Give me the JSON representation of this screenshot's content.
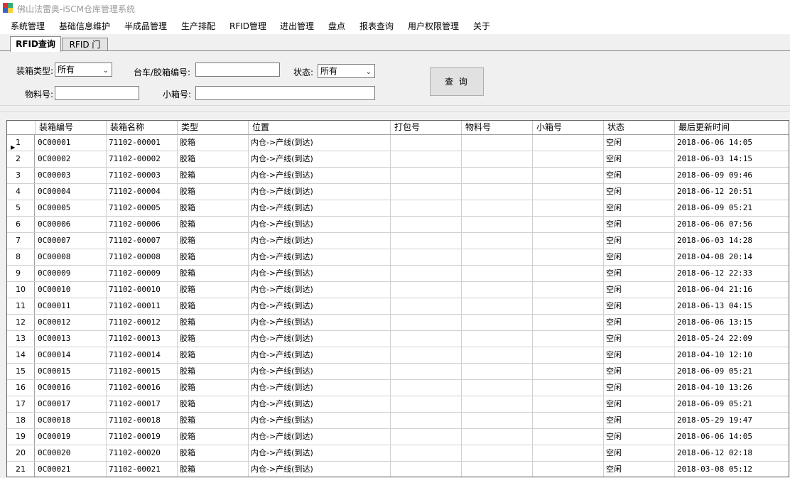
{
  "window": {
    "title": "佛山法雷奥-iSCM仓库管理系统"
  },
  "menu": [
    "系统管理",
    "基础信息维护",
    "半成品管理",
    "生产排配",
    "RFID管理",
    "进出管理",
    "盘点",
    "报表查询",
    "用户权限管理",
    "关于"
  ],
  "tabs": [
    {
      "label": "RFID查询",
      "active": true
    },
    {
      "label": "RFID 门",
      "active": false
    }
  ],
  "filters": {
    "box_type_label": "装箱类型:",
    "box_type_value": "所有",
    "cart_label": "台车/胶箱编号:",
    "cart_value": "",
    "status_label": "状态:",
    "status_value": "所有",
    "material_label": "物料号:",
    "material_value": "",
    "smallbox_label": "小箱号:",
    "smallbox_value": "",
    "query_button": "查 询"
  },
  "grid": {
    "columns": [
      "装箱编号",
      "装箱名称",
      "类型",
      "位置",
      "打包号",
      "物料号",
      "小箱号",
      "状态",
      "最后更新时间"
    ],
    "rows": [
      {
        "n": "1",
        "code": "0C00001",
        "name": "71102-00001",
        "type": "胶箱",
        "loc": "内仓->产线(到达)",
        "pack": "",
        "mat": "",
        "small": "",
        "status": "空闲",
        "time": "2018-06-06 14:05"
      },
      {
        "n": "2",
        "code": "0C00002",
        "name": "71102-00002",
        "type": "胶箱",
        "loc": "内仓->产线(到达)",
        "pack": "",
        "mat": "",
        "small": "",
        "status": "空闲",
        "time": "2018-06-03 14:15"
      },
      {
        "n": "3",
        "code": "0C00003",
        "name": "71102-00003",
        "type": "胶箱",
        "loc": "内仓->产线(到达)",
        "pack": "",
        "mat": "",
        "small": "",
        "status": "空闲",
        "time": "2018-06-09 09:46"
      },
      {
        "n": "4",
        "code": "0C00004",
        "name": "71102-00004",
        "type": "胶箱",
        "loc": "内仓->产线(到达)",
        "pack": "",
        "mat": "",
        "small": "",
        "status": "空闲",
        "time": "2018-06-12 20:51"
      },
      {
        "n": "5",
        "code": "0C00005",
        "name": "71102-00005",
        "type": "胶箱",
        "loc": "内仓->产线(到达)",
        "pack": "",
        "mat": "",
        "small": "",
        "status": "空闲",
        "time": "2018-06-09 05:21"
      },
      {
        "n": "6",
        "code": "0C00006",
        "name": "71102-00006",
        "type": "胶箱",
        "loc": "内仓->产线(到达)",
        "pack": "",
        "mat": "",
        "small": "",
        "status": "空闲",
        "time": "2018-06-06 07:56"
      },
      {
        "n": "7",
        "code": "0C00007",
        "name": "71102-00007",
        "type": "胶箱",
        "loc": "内仓->产线(到达)",
        "pack": "",
        "mat": "",
        "small": "",
        "status": "空闲",
        "time": "2018-06-03 14:28"
      },
      {
        "n": "8",
        "code": "0C00008",
        "name": "71102-00008",
        "type": "胶箱",
        "loc": "内仓->产线(到达)",
        "pack": "",
        "mat": "",
        "small": "",
        "status": "空闲",
        "time": "2018-04-08 20:14"
      },
      {
        "n": "9",
        "code": "0C00009",
        "name": "71102-00009",
        "type": "胶箱",
        "loc": "内仓->产线(到达)",
        "pack": "",
        "mat": "",
        "small": "",
        "status": "空闲",
        "time": "2018-06-12 22:33"
      },
      {
        "n": "10",
        "code": "0C00010",
        "name": "71102-00010",
        "type": "胶箱",
        "loc": "内仓->产线(到达)",
        "pack": "",
        "mat": "",
        "small": "",
        "status": "空闲",
        "time": "2018-06-04 21:16"
      },
      {
        "n": "11",
        "code": "0C00011",
        "name": "71102-00011",
        "type": "胶箱",
        "loc": "内仓->产线(到达)",
        "pack": "",
        "mat": "",
        "small": "",
        "status": "空闲",
        "time": "2018-06-13 04:15"
      },
      {
        "n": "12",
        "code": "0C00012",
        "name": "71102-00012",
        "type": "胶箱",
        "loc": "内仓->产线(到达)",
        "pack": "",
        "mat": "",
        "small": "",
        "status": "空闲",
        "time": "2018-06-06 13:15"
      },
      {
        "n": "13",
        "code": "0C00013",
        "name": "71102-00013",
        "type": "胶箱",
        "loc": "内仓->产线(到达)",
        "pack": "",
        "mat": "",
        "small": "",
        "status": "空闲",
        "time": "2018-05-24 22:09"
      },
      {
        "n": "14",
        "code": "0C00014",
        "name": "71102-00014",
        "type": "胶箱",
        "loc": "内仓->产线(到达)",
        "pack": "",
        "mat": "",
        "small": "",
        "status": "空闲",
        "time": "2018-04-10 12:10"
      },
      {
        "n": "15",
        "code": "0C00015",
        "name": "71102-00015",
        "type": "胶箱",
        "loc": "内仓->产线(到达)",
        "pack": "",
        "mat": "",
        "small": "",
        "status": "空闲",
        "time": "2018-06-09 05:21"
      },
      {
        "n": "16",
        "code": "0C00016",
        "name": "71102-00016",
        "type": "胶箱",
        "loc": "内仓->产线(到达)",
        "pack": "",
        "mat": "",
        "small": "",
        "status": "空闲",
        "time": "2018-04-10 13:26"
      },
      {
        "n": "17",
        "code": "0C00017",
        "name": "71102-00017",
        "type": "胶箱",
        "loc": "内仓->产线(到达)",
        "pack": "",
        "mat": "",
        "small": "",
        "status": "空闲",
        "time": "2018-06-09 05:21"
      },
      {
        "n": "18",
        "code": "0C00018",
        "name": "71102-00018",
        "type": "胶箱",
        "loc": "内仓->产线(到达)",
        "pack": "",
        "mat": "",
        "small": "",
        "status": "空闲",
        "time": "2018-05-29 19:47"
      },
      {
        "n": "19",
        "code": "0C00019",
        "name": "71102-00019",
        "type": "胶箱",
        "loc": "内仓->产线(到达)",
        "pack": "",
        "mat": "",
        "small": "",
        "status": "空闲",
        "time": "2018-06-06 14:05"
      },
      {
        "n": "20",
        "code": "0C00020",
        "name": "71102-00020",
        "type": "胶箱",
        "loc": "内仓->产线(到达)",
        "pack": "",
        "mat": "",
        "small": "",
        "status": "空闲",
        "time": "2018-06-12 02:18"
      },
      {
        "n": "21",
        "code": "0C00021",
        "name": "71102-00021",
        "type": "胶箱",
        "loc": "内仓->产线(到达)",
        "pack": "",
        "mat": "",
        "small": "",
        "status": "空闲",
        "time": "2018-03-08 05:12"
      }
    ]
  }
}
